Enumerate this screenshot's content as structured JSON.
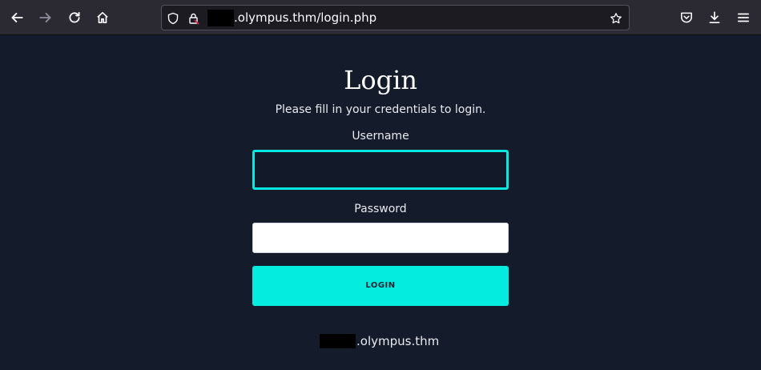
{
  "browser": {
    "url_visible_text": ".olympus.thm/login.php",
    "icons": [
      "back-arrow-icon",
      "forward-arrow-icon",
      "reload-icon",
      "home-icon",
      "shield-icon",
      "lock-icon",
      "bookmark-star-icon",
      "pocket-icon",
      "download-icon",
      "menu-icon"
    ]
  },
  "page": {
    "title": "Login",
    "subtitle": "Please fill in your credentials to login.",
    "username_label": "Username",
    "username_value": "",
    "password_label": "Password",
    "password_value": "",
    "login_button": "LOGIN",
    "footer_domain": ".olympus.thm"
  },
  "colors": {
    "background": "#141c2b",
    "accent": "#04ece0",
    "toolbar": "#2b2a33"
  }
}
